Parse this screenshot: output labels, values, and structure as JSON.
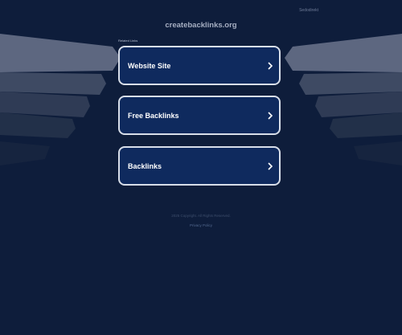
{
  "header": {
    "top_link_label": "Sedodirekt",
    "domain": "createbacklinks.org",
    "related_label": "Related Links"
  },
  "links": [
    {
      "label": "Website Site"
    },
    {
      "label": "Free Backlinks"
    },
    {
      "label": "Backlinks"
    }
  ],
  "footer": {
    "copyright": "2025 Copyright. All Rights Reserved.",
    "privacy_label": "Privacy Policy"
  },
  "colors": {
    "background": "#0e1d3b",
    "card_fill": "#0f2a5e",
    "card_border": "#d8dee9"
  },
  "icons": {
    "card_arrow": "chevron-right-icon"
  }
}
